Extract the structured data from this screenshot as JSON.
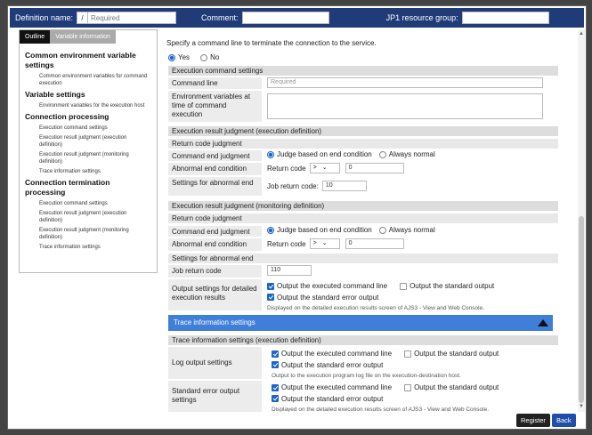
{
  "header": {
    "definition_label": "Definition name:",
    "definition_prefix": "/",
    "definition_placeholder": "Required",
    "comment_label": "Comment:",
    "jp1_label": "JP1 resource group:"
  },
  "left": {
    "tabs": [
      "Outline",
      "Variable information"
    ],
    "tree": [
      {
        "kind": "h",
        "label": "Common environment variable settings"
      },
      {
        "kind": "s",
        "label": "Common environment variables for command execution"
      },
      {
        "kind": "h",
        "label": "Variable settings"
      },
      {
        "kind": "s",
        "label": "Environment variables for the execution host"
      },
      {
        "kind": "h",
        "label": "Connection processing"
      },
      {
        "kind": "s",
        "label": "Execution command settings"
      },
      {
        "kind": "s",
        "label": "Execution result judgment (execution definition)"
      },
      {
        "kind": "s",
        "label": "Execution result judgment (monitoring definition)"
      },
      {
        "kind": "s",
        "label": "Trace information settings"
      },
      {
        "kind": "h",
        "label": "Connection termination processing"
      },
      {
        "kind": "s",
        "label": "Execution command settings"
      },
      {
        "kind": "s",
        "label": "Execution result judgment (execution definition)"
      },
      {
        "kind": "s",
        "label": "Execution result judgment (monitoring definition)"
      },
      {
        "kind": "s",
        "label": "Trace information settings"
      }
    ]
  },
  "main": {
    "intro": "Specify a command line to terminate the connection to the service.",
    "yes": "Yes",
    "no": "No",
    "exec_cmd_settings": "Execution command settings",
    "command_line": "Command line",
    "command_placeholder": "Required",
    "env_vars": "Environment variables at time of command execution",
    "erj_exec": "Execution result judgment (execution definition)",
    "return_code_judgment": "Return code judgment",
    "command_end_judgment": "Command end judgment",
    "judge_based": "Judge based on end condition",
    "always_normal": "Always normal",
    "abnormal_end_condition": "Abnormal end condition",
    "return_code": "Return code",
    "op_value": ">",
    "rc_value": "0",
    "settings_abnormal_end": "Settings for abnormal end",
    "job_return_code_label": "Job return code:",
    "job_return_code_value": "10",
    "erj_mon": "Execution result judgment (monitoring definition)",
    "return_code_judgment_2": "Return code judgment",
    "command_end_judgment_2": "Command end judgment",
    "judge_based_2": "Judge based on end condition",
    "always_normal_2": "Always normal",
    "abnormal_end_condition_2": "Abnormal end condition",
    "return_code_2": "Return code",
    "op_value_2": ">",
    "rc_value_2": "0",
    "settings_abnormal_end_2": "Settings for abnormal end",
    "job_return_code_2": "Job return code",
    "job_return_code_value_2": "110",
    "output_settings": "Output settings for detailed execution results",
    "out_executed_cmd": "Output the executed command line",
    "out_standard": "Output the standard output",
    "out_std_error": "Output the standard error output",
    "out_note": "Displayed on the detailed execution results screen of AJS3 - View and Web Console.",
    "trace_bar": "Trace information settings",
    "trace_exec": "Trace information settings (execution definition)",
    "log_output": "Log output settings",
    "log_executed_cmd": "Output the executed command line",
    "log_standard": "Output the standard output",
    "log_std_error": "Output the standard error output",
    "log_note": "Output to the execution program log file on the execution-destination host.",
    "stderr_settings": "Standard error output settings",
    "se_executed_cmd": "Output the executed command line",
    "se_standard": "Output the standard output",
    "se_std_error": "Output the standard error output",
    "se_note": "Displayed on the detailed execution results screen of AJS3 - View and Web Console."
  },
  "footer": {
    "register": "Register",
    "back": "Back"
  }
}
